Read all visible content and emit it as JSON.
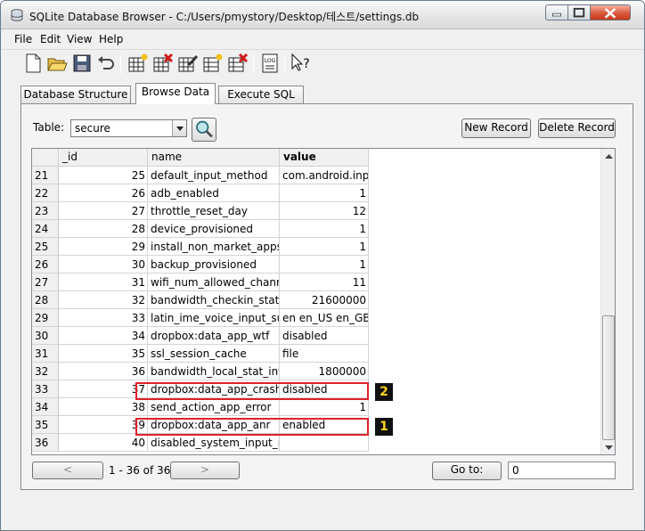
{
  "window": {
    "title": "SQLite Database Browser - C:/Users/pmystory/Desktop/테스트/settings.db"
  },
  "menu": {
    "items": [
      "File",
      "Edit",
      "View",
      "Help"
    ]
  },
  "toolbar": {
    "buttons": [
      "new-database",
      "open-database",
      "save-database",
      "undo",
      "create-table",
      "delete-table",
      "modify-table",
      "create-index",
      "delete-index",
      "sql-log",
      "whats-this"
    ]
  },
  "tabs": [
    "Database Structure",
    "Browse Data",
    "Execute SQL"
  ],
  "browse": {
    "table_label": "Table:",
    "table_value": "secure",
    "new_record_label": "New Record",
    "delete_record_label": "Delete Record",
    "columns": [
      "_id",
      "name",
      "value"
    ],
    "rows": [
      {
        "row": "21",
        "id": "25",
        "name": "default_input_method",
        "value": "com.android.inpu"
      },
      {
        "row": "22",
        "id": "26",
        "name": "adb_enabled",
        "value": "1"
      },
      {
        "row": "23",
        "id": "27",
        "name": "throttle_reset_day",
        "value": "12"
      },
      {
        "row": "24",
        "id": "28",
        "name": "device_provisioned",
        "value": "1"
      },
      {
        "row": "25",
        "id": "29",
        "name": "install_non_market_apps",
        "value": "1"
      },
      {
        "row": "26",
        "id": "30",
        "name": "backup_provisioned",
        "value": "1"
      },
      {
        "row": "27",
        "id": "31",
        "name": "wifi_num_allowed_channe",
        "value": "11"
      },
      {
        "row": "28",
        "id": "32",
        "name": "bandwidth_checkin_stat_i",
        "value": "21600000"
      },
      {
        "row": "29",
        "id": "33",
        "name": "latin_ime_voice_input_sup",
        "value": "en en_US en_GB"
      },
      {
        "row": "30",
        "id": "34",
        "name": "dropbox:data_app_wtf",
        "value": "disabled"
      },
      {
        "row": "31",
        "id": "35",
        "name": "ssl_session_cache",
        "value": "file"
      },
      {
        "row": "32",
        "id": "36",
        "name": "bandwidth_local_stat_inte",
        "value": "1800000"
      },
      {
        "row": "33",
        "id": "37",
        "name": "dropbox:data_app_crash",
        "value": "disabled"
      },
      {
        "row": "34",
        "id": "38",
        "name": "send_action_app_error",
        "value": "1"
      },
      {
        "row": "35",
        "id": "39",
        "name": "dropbox:data_app_anr",
        "value": "enabled"
      },
      {
        "row": "36",
        "id": "40",
        "name": "disabled_system_input_m",
        "value": ""
      }
    ],
    "prev_label": "<",
    "next_label": ">",
    "record_count": "1 - 36 of 36",
    "goto_label": "Go to:",
    "goto_value": "0"
  },
  "annotations": [
    {
      "label": "2",
      "row": "33"
    },
    {
      "label": "1",
      "row": "35"
    }
  ],
  "colors": {
    "highlight": "#e0202a",
    "badge_bg": "#111111",
    "badge_text": "#ffd21a"
  }
}
